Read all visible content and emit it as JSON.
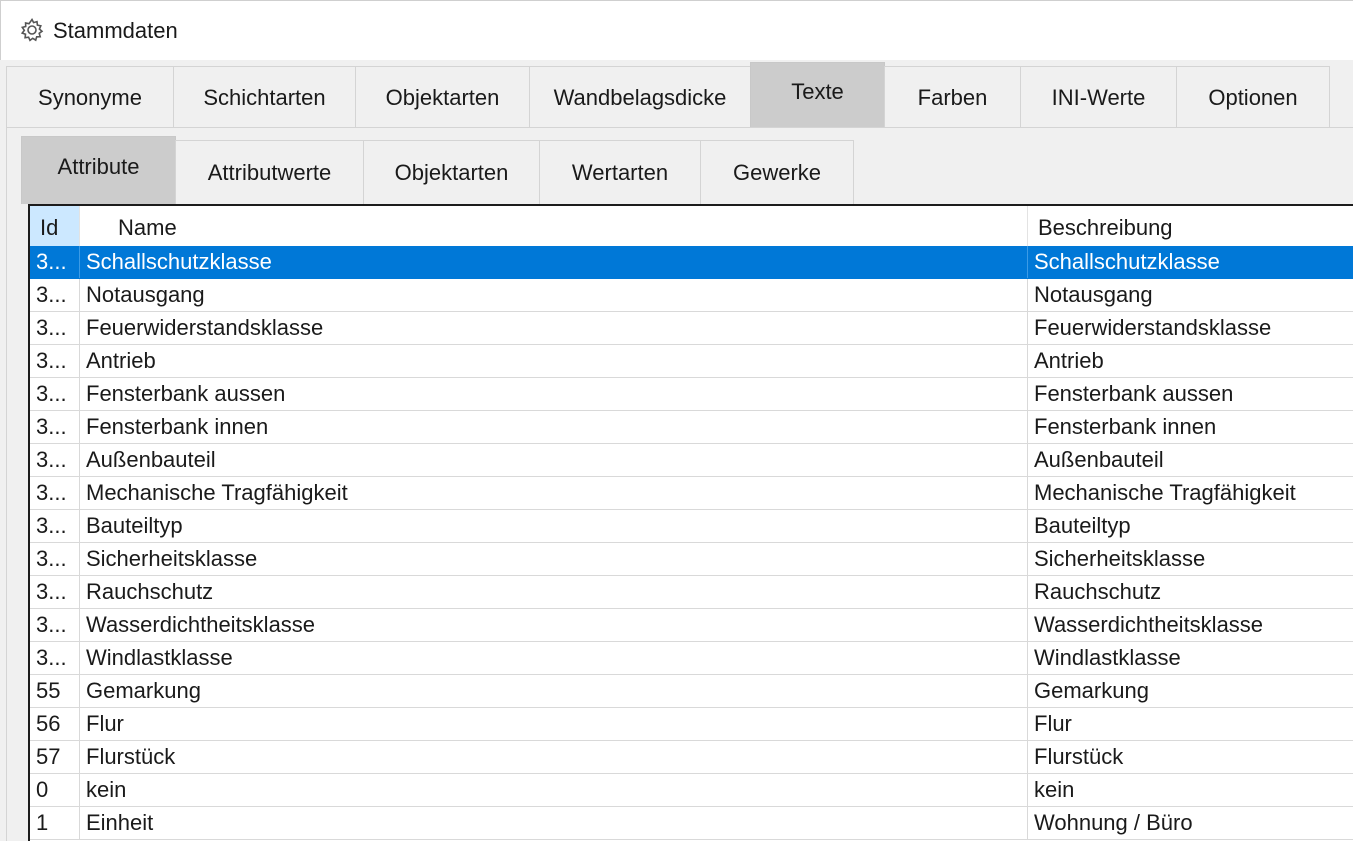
{
  "window": {
    "title": "Stammdaten",
    "icon": "gear-icon"
  },
  "main_tabs": [
    {
      "label": "Synonyme",
      "active": false
    },
    {
      "label": "Schichtarten",
      "active": false
    },
    {
      "label": "Objektarten",
      "active": false
    },
    {
      "label": "Wandbelagsdicke",
      "active": false
    },
    {
      "label": "Texte",
      "active": true
    },
    {
      "label": "Farben",
      "active": false
    },
    {
      "label": "INI-Werte",
      "active": false
    },
    {
      "label": "Optionen",
      "active": false
    }
  ],
  "sub_tabs": [
    {
      "label": "Attribute",
      "active": true
    },
    {
      "label": "Attributwerte",
      "active": false
    },
    {
      "label": "Objektarten",
      "active": false
    },
    {
      "label": "Wertarten",
      "active": false
    },
    {
      "label": "Gewerke",
      "active": false
    }
  ],
  "table": {
    "columns": {
      "id": "Id",
      "name": "Name",
      "description": "Beschreibung"
    },
    "rows": [
      {
        "id": "3...",
        "name": "Schallschutzklasse",
        "description": "Schallschutzklasse",
        "selected": true
      },
      {
        "id": "3...",
        "name": "Notausgang",
        "description": "Notausgang"
      },
      {
        "id": "3...",
        "name": "Feuerwiderstandsklasse",
        "description": "Feuerwiderstandsklasse"
      },
      {
        "id": "3...",
        "name": "Antrieb",
        "description": "Antrieb"
      },
      {
        "id": "3...",
        "name": "Fensterbank aussen",
        "description": "Fensterbank aussen"
      },
      {
        "id": "3...",
        "name": "Fensterbank innen",
        "description": "Fensterbank innen"
      },
      {
        "id": "3...",
        "name": "Außenbauteil",
        "description": "Außenbauteil"
      },
      {
        "id": "3...",
        "name": "Mechanische Tragfähigkeit",
        "description": "Mechanische Tragfähigkeit"
      },
      {
        "id": "3...",
        "name": "Bauteiltyp",
        "description": "Bauteiltyp"
      },
      {
        "id": "3...",
        "name": "Sicherheitsklasse",
        "description": "Sicherheitsklasse"
      },
      {
        "id": "3...",
        "name": "Rauchschutz",
        "description": "Rauchschutz"
      },
      {
        "id": "3...",
        "name": "Wasserdichtheitsklasse",
        "description": "Wasserdichtheitsklasse"
      },
      {
        "id": "3...",
        "name": "Windlastklasse",
        "description": "Windlastklasse"
      },
      {
        "id": "55",
        "name": "Gemarkung",
        "description": "Gemarkung"
      },
      {
        "id": "56",
        "name": "Flur",
        "description": "Flur"
      },
      {
        "id": "57",
        "name": "Flurstück",
        "description": "Flurstück"
      },
      {
        "id": "0",
        "name": "kein",
        "description": "kein"
      },
      {
        "id": "1",
        "name": "Einheit",
        "description": "Wohnung / Büro"
      }
    ]
  },
  "colors": {
    "selection": "#0078d7",
    "active_tab": "#cccccc",
    "header_id_highlight": "#cce8ff"
  }
}
